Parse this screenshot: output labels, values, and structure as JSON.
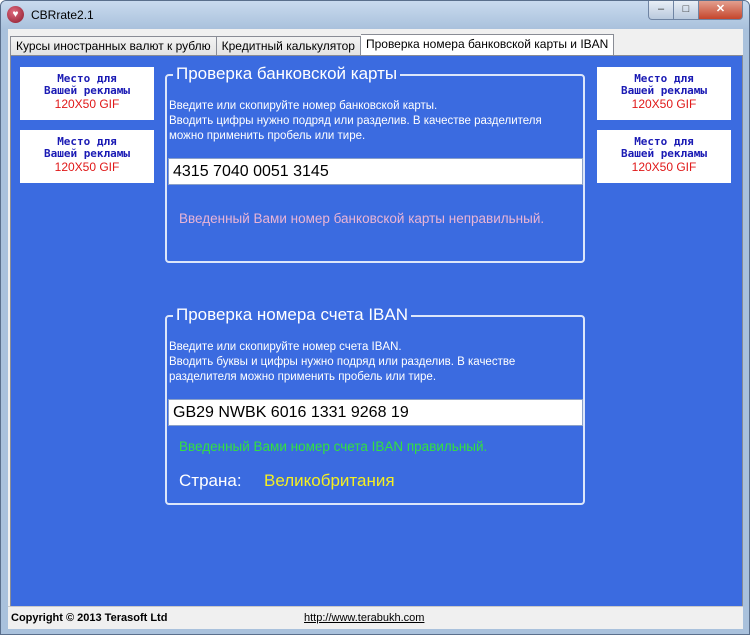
{
  "window": {
    "title": "CBRrate2.1",
    "icon": "app-logo-icon",
    "controls": {
      "minimize": "–",
      "maximize": "□",
      "close": "✕"
    }
  },
  "tabs": [
    {
      "label": "Курсы иностранных валют к рублю",
      "active": false
    },
    {
      "label": "Кредитный калькулятор",
      "active": false
    },
    {
      "label": "Проверка номера банковской карты и IBAN",
      "active": true
    }
  ],
  "ads": {
    "line1": "Место для",
    "line2": "Вашей рекламы",
    "line3": "120X50 GIF"
  },
  "card_check": {
    "title": "Проверка банковской карты",
    "instructions": [
      "Введите или скопируйте номер банковской карты.",
      "Вводить цифры нужно подряд или разделив. В качестве разделителя",
      "можно применить пробель или тире."
    ],
    "value": "4315 7040 0051 3145",
    "result": "Введенный Вами номер банковской карты неправильный."
  },
  "iban_check": {
    "title": "Проверка номера счета IBAN",
    "instructions": [
      "Введите или скопируйте номер счета IBAN.",
      "Вводить буквы и цифры нужно подряд или разделив. В качестве",
      "разделителя можно применить пробель или тире."
    ],
    "value": "GB29 NWBK 6016 1331 9268 19",
    "result": "Введенный Вами номер счета IBAN правильный.",
    "country_label": "Страна:",
    "country_value": "Великобритания"
  },
  "status": {
    "copyright": "Copyright © 2013 Terasoft Ltd",
    "link": "http://www.terabukh.com"
  },
  "colors": {
    "panel_bg": "#3b6be0",
    "error_text": "#e9b4d6",
    "success_text": "#33e040",
    "country_value": "#f4ee22"
  }
}
